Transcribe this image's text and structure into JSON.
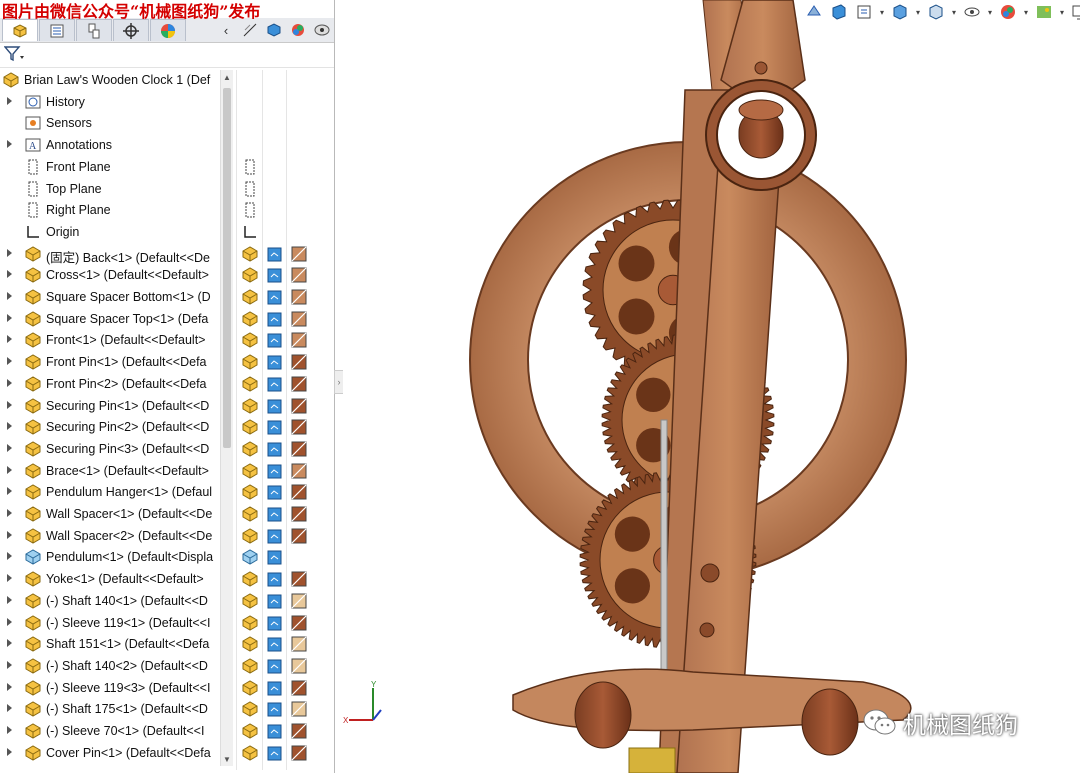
{
  "watermark_top": "图片由微信公众号“机械图纸狗”发布",
  "watermark_bottom": "机械图纸狗",
  "tabs": [
    {
      "name": "feature-manager",
      "icon": "feature-manager-icon"
    },
    {
      "name": "property-manager",
      "icon": "property-manager-icon"
    },
    {
      "name": "configuration-manager",
      "icon": "configuration-manager-icon"
    },
    {
      "name": "dimxpert-manager",
      "icon": "dimxpert-icon"
    },
    {
      "name": "display-manager",
      "icon": "display-manager-icon"
    }
  ],
  "filter_label": "filter",
  "tree": {
    "root": "Brian Law's Wooden Clock 1  (Def",
    "items": [
      {
        "label": "History",
        "icon": "history-icon",
        "expand": true
      },
      {
        "label": "Sensors",
        "icon": "sensors-icon",
        "expand": false
      },
      {
        "label": "Annotations",
        "icon": "annotations-icon",
        "expand": true
      },
      {
        "label": "Front Plane",
        "icon": "plane-icon",
        "expand": false
      },
      {
        "label": "Top Plane",
        "icon": "plane-icon",
        "expand": false
      },
      {
        "label": "Right Plane",
        "icon": "plane-icon",
        "expand": false
      },
      {
        "label": "Origin",
        "icon": "origin-icon",
        "expand": false
      },
      {
        "label": "(固定) Back<1> (Default<<De",
        "icon": "part-icon",
        "expand": true
      },
      {
        "label": "Cross<1> (Default<<Default>",
        "icon": "part-icon",
        "expand": true
      },
      {
        "label": "Square Spacer Bottom<1> (D",
        "icon": "part-icon",
        "expand": true
      },
      {
        "label": "Square Spacer Top<1> (Defa",
        "icon": "part-icon",
        "expand": true
      },
      {
        "label": "Front<1> (Default<<Default>",
        "icon": "part-icon",
        "expand": true
      },
      {
        "label": "Front Pin<1> (Default<<Defa",
        "icon": "part-icon",
        "expand": true
      },
      {
        "label": "Front Pin<2> (Default<<Defa",
        "icon": "part-icon",
        "expand": true
      },
      {
        "label": "Securing Pin<1> (Default<<D",
        "icon": "part-icon",
        "expand": true
      },
      {
        "label": "Securing Pin<2> (Default<<D",
        "icon": "part-icon",
        "expand": true
      },
      {
        "label": "Securing Pin<3> (Default<<D",
        "icon": "part-icon",
        "expand": true
      },
      {
        "label": "Brace<1> (Default<<Default>",
        "icon": "part-icon",
        "expand": true
      },
      {
        "label": "Pendulum Hanger<1> (Defaul",
        "icon": "part-icon",
        "expand": true
      },
      {
        "label": "Wall Spacer<1> (Default<<De",
        "icon": "part-icon",
        "expand": true
      },
      {
        "label": "Wall Spacer<2> (Default<<De",
        "icon": "part-icon",
        "expand": true
      },
      {
        "label": "Pendulum<1> (Default<Displa",
        "icon": "subassembly-icon",
        "expand": true
      },
      {
        "label": "Yoke<1> (Default<<Default>",
        "icon": "part-icon",
        "expand": true
      },
      {
        "label": "(-) Shaft 140<1> (Default<<D",
        "icon": "part-icon",
        "expand": true
      },
      {
        "label": "(-) Sleeve 119<1> (Default<<I",
        "icon": "part-icon",
        "expand": true
      },
      {
        "label": "Shaft 151<1> (Default<<Defa",
        "icon": "part-icon",
        "expand": true
      },
      {
        "label": "(-) Shaft 140<2> (Default<<D",
        "icon": "part-icon",
        "expand": true
      },
      {
        "label": "(-) Sleeve 119<3> (Default<<I",
        "icon": "part-icon",
        "expand": true
      },
      {
        "label": "(-) Shaft 175<1> (Default<<D",
        "icon": "part-icon",
        "expand": true
      },
      {
        "label": "(-) Sleeve 70<1> (Default<<I",
        "icon": "part-icon",
        "expand": true
      },
      {
        "label": "Cover Pin<1> (Default<<Defa",
        "icon": "part-icon",
        "expand": true
      }
    ]
  },
  "appearance_colors": {
    "wood": "#a0522d",
    "wood_light": "#c98a5e",
    "pale_wood": "#e8c89a",
    "brass": "#d6b23a"
  },
  "heads_up_toolbar": [
    "zoom-to-fit-icon",
    "zoom-area-icon",
    "previous-view-icon",
    "section-view-icon",
    "dynamic-annotation-icon",
    "view-orientation-icon",
    "display-style-icon",
    "hide-show-icon",
    "edit-appearance-icon",
    "apply-scene-icon",
    "view-settings-icon"
  ]
}
